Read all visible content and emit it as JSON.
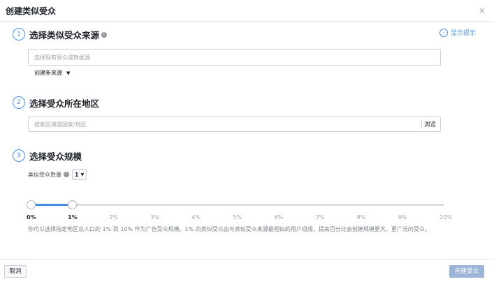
{
  "dialog": {
    "title": "创建类似受众",
    "close": "×",
    "show_tips": "显示提示"
  },
  "step1": {
    "number": "1",
    "title": "选择类似受众来源",
    "info": "i",
    "source_placeholder": "选择现有受众或数据源",
    "create_new": "创建新来源"
  },
  "step2": {
    "number": "2",
    "title": "选择受众所在地区",
    "location_placeholder": "搜索区域或国家/地区",
    "browse": "浏览"
  },
  "step3": {
    "number": "3",
    "title": "选择受众规模",
    "count_label": "类似受众数量",
    "info": "i",
    "count_value": "1",
    "ticks": [
      "0%",
      "1%",
      "2%",
      "3%",
      "4%",
      "5%",
      "6%",
      "7%",
      "8%",
      "9%",
      "10%"
    ],
    "range_start": 0,
    "range_end": 1,
    "description": "你可以选择指定地区总人口的 1% 到 10% 作为广告受众规模。1% 的类似受众由与类似受众来源最相似的用户组成，提高百分比会创建规模更大、更广泛的受众。"
  },
  "footer": {
    "cancel": "取消",
    "create": "创建受众"
  },
  "colors": {
    "accent": "#4a90e2",
    "slider_fill": "#4a90e2",
    "primary_disabled": "#9cb4d8"
  }
}
